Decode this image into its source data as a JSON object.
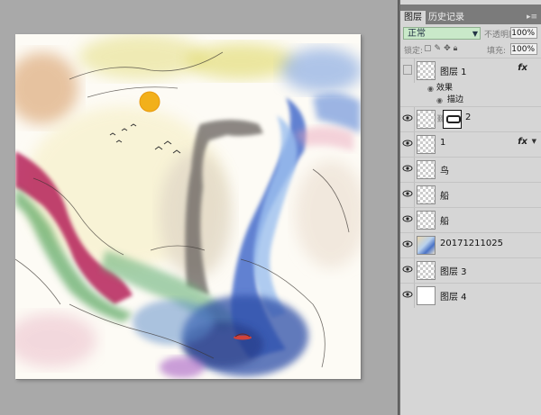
{
  "panel": {
    "tabs": [
      {
        "label": "图层",
        "active": true
      },
      {
        "label": "历史记录",
        "active": false
      }
    ],
    "menu_icon": "double-arrow-menu-icon",
    "blend_mode": "正常",
    "opacity_label": "不透明度:",
    "opacity_value": "100%",
    "lock_label": "锁定:",
    "fill_label": "填充:",
    "fill_value": "100%"
  },
  "layers": [
    {
      "name": "图层 1",
      "visible": false,
      "fx": "fx",
      "thumb": "transparent"
    },
    {
      "effects_label": "效果",
      "effect_item": "描边"
    },
    {
      "name": "2",
      "visible": true,
      "mask": true,
      "thumb": "transparent"
    },
    {
      "name": "1",
      "visible": true,
      "fx": "fx",
      "thumb": "transparent"
    },
    {
      "name": "鸟",
      "visible": true,
      "thumb": "transparent"
    },
    {
      "name": "船",
      "visible": true,
      "thumb": "transparent"
    },
    {
      "name": "船",
      "visible": true,
      "thumb": "transparent"
    },
    {
      "name": "20171211025",
      "visible": true,
      "thumb": "image"
    },
    {
      "name": "图层 3",
      "visible": true,
      "thumb": "transparent"
    },
    {
      "name": "图层 4",
      "visible": true,
      "thumb": "white"
    }
  ],
  "colors": {
    "workspace": "#a9a9a9",
    "panel": "#d6d6d6",
    "blend_field": "#c9e9c9"
  }
}
